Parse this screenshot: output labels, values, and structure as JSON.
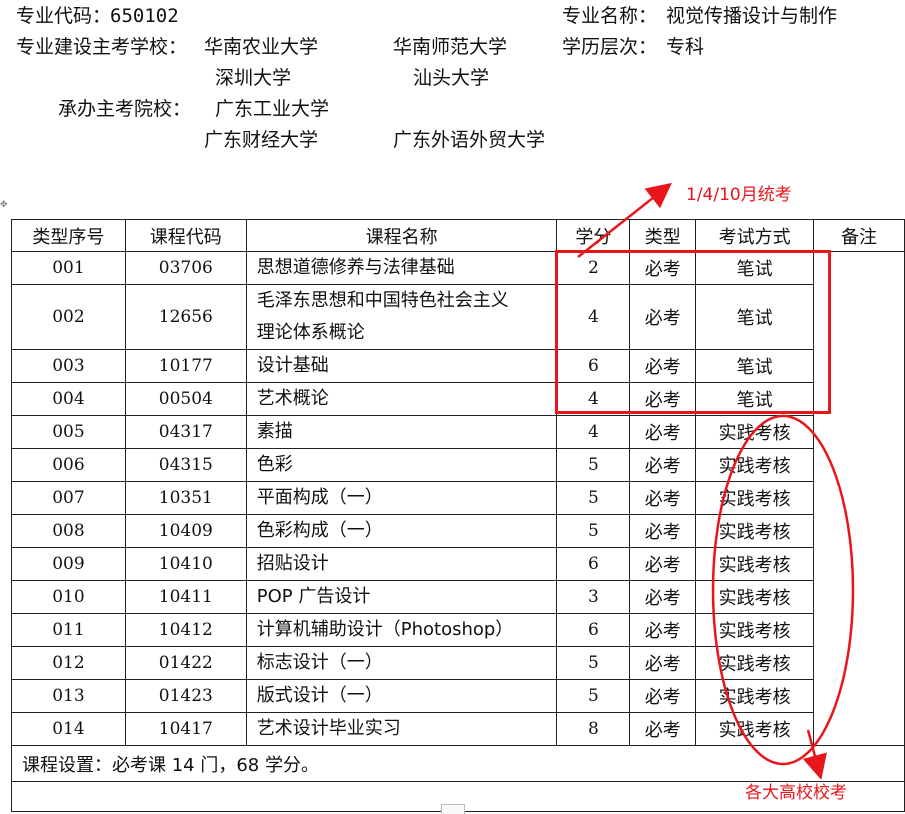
{
  "header": {
    "major_code_label": "专业代码：",
    "major_code": "650102",
    "major_name_label": "专业名称：",
    "major_name": "视觉传播设计与制作",
    "build_schools_label": "专业建设主考学校：",
    "build_schools": [
      "华南农业大学",
      "华南师范大学",
      "深圳大学",
      "汕头大学"
    ],
    "level_label": "学历层次：",
    "level": "专科",
    "host_schools_label": "承办主考院校：",
    "host_schools": [
      "广东工业大学",
      "广东财经大学",
      "广东外语外贸大学"
    ]
  },
  "table": {
    "headers": [
      "类型序号",
      "课程代码",
      "课程名称",
      "学分",
      "类型",
      "考试方式",
      "备注"
    ],
    "rows": [
      {
        "seq": "001",
        "code": "03706",
        "name": "思想道德修养与法律基础",
        "name2": "",
        "credit": "2",
        "type": "必考",
        "exam": "笔试"
      },
      {
        "seq": "002",
        "code": "12656",
        "name": "毛泽东思想和中国特色社会主义",
        "name2": "理论体系概论",
        "credit": "4",
        "type": "必考",
        "exam": "笔试"
      },
      {
        "seq": "003",
        "code": "10177",
        "name": "设计基础",
        "name2": "",
        "credit": "6",
        "type": "必考",
        "exam": "笔试"
      },
      {
        "seq": "004",
        "code": "00504",
        "name": "艺术概论",
        "name2": "",
        "credit": "4",
        "type": "必考",
        "exam": "笔试"
      },
      {
        "seq": "005",
        "code": "04317",
        "name": "素描",
        "name2": "",
        "credit": "4",
        "type": "必考",
        "exam": "实践考核"
      },
      {
        "seq": "006",
        "code": "04315",
        "name": "色彩",
        "name2": "",
        "credit": "5",
        "type": "必考",
        "exam": "实践考核"
      },
      {
        "seq": "007",
        "code": "10351",
        "name": "平面构成（一）",
        "name2": "",
        "credit": "5",
        "type": "必考",
        "exam": "实践考核"
      },
      {
        "seq": "008",
        "code": "10409",
        "name": "色彩构成（一）",
        "name2": "",
        "credit": "5",
        "type": "必考",
        "exam": "实践考核"
      },
      {
        "seq": "009",
        "code": "10410",
        "name": "招贴设计",
        "name2": "",
        "credit": "6",
        "type": "必考",
        "exam": "实践考核"
      },
      {
        "seq": "010",
        "code": "10411",
        "name": "POP 广告设计",
        "name2": "",
        "credit": "3",
        "type": "必考",
        "exam": "实践考核"
      },
      {
        "seq": "011",
        "code": "10412",
        "name": "计算机辅助设计（Photoshop）",
        "name2": "",
        "credit": "6",
        "type": "必考",
        "exam": "实践考核"
      },
      {
        "seq": "012",
        "code": "01422",
        "name": "标志设计（一）",
        "name2": "",
        "credit": "5",
        "type": "必考",
        "exam": "实践考核"
      },
      {
        "seq": "013",
        "code": "01423",
        "name": "版式设计（一）",
        "name2": "",
        "credit": "5",
        "type": "必考",
        "exam": "实践考核"
      },
      {
        "seq": "014",
        "code": "10417",
        "name": "艺术设计毕业实习",
        "name2": "",
        "credit": "8",
        "type": "必考",
        "exam": "实践考核"
      }
    ],
    "summary": "课程设置：必考课 14 门，68 学分。"
  },
  "annotations": {
    "unified_exam": "1/4/10月统考",
    "school_exam": "各大高校校考",
    "color": "#e8161b"
  }
}
